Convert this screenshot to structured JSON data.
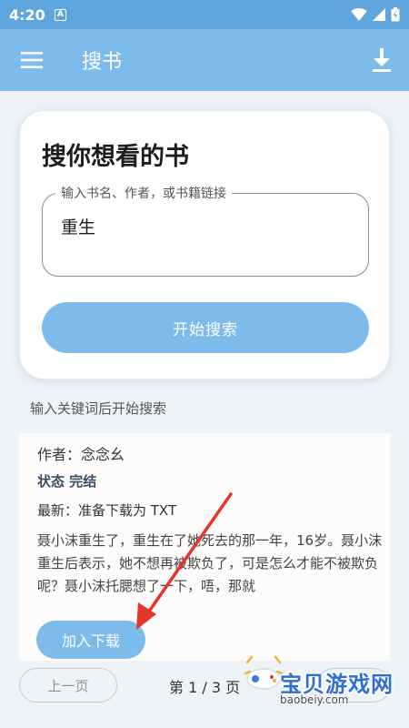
{
  "status_bar": {
    "time": "4:20",
    "notification_letter": "A"
  },
  "app_bar": {
    "title": "搜书"
  },
  "search": {
    "heading": "搜你想看的书",
    "field_label": "输入书名、作者，或书籍链接",
    "field_value": "重生",
    "button_label": "开始搜索"
  },
  "hint": "输入关键词后开始搜索",
  "result": {
    "author": "作者：念念幺",
    "status": "状态 完结",
    "latest": "最新：准备下载为 TXT",
    "description": "聂小沫重生了，重生在了她死去的那一年，16岁。聂小沫重生后表示，她不想再被欺负了，可是怎么才能不被欺负呢？聂小沫托腮想了一下，唔，那就",
    "add_button": "加入下载"
  },
  "pagination": {
    "prev_label": "上一页",
    "page_info": "第 1 / 3 页"
  },
  "watermark": {
    "text": "宝贝游戏网",
    "url": "baobeiy.com"
  },
  "colors": {
    "status_bar": "#5ea6dd",
    "app_bar": "#7dbbeb",
    "accent": "#7dbbeb",
    "annotation_arrow": "#e5352c"
  },
  "icons": {
    "menu": "menu-icon",
    "download": "download-icon",
    "wifi": "wifi-icon",
    "signal": "signal-icon",
    "battery": "battery-icon"
  }
}
